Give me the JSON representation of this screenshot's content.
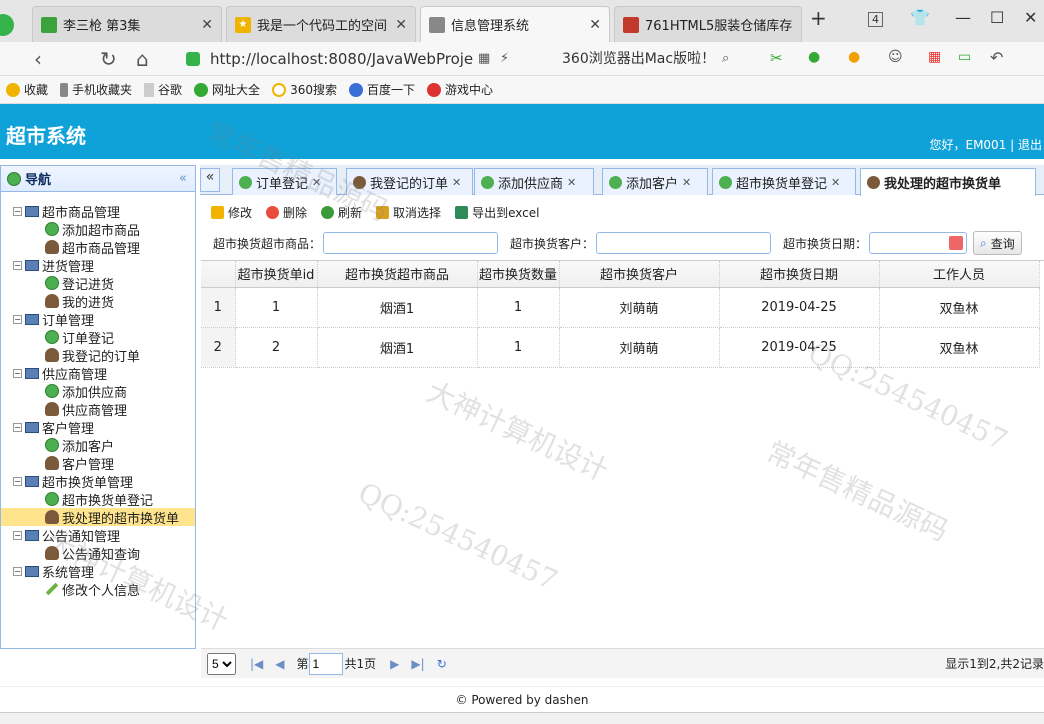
{
  "browser": {
    "tabs": [
      {
        "title": "李三枪 第3集",
        "color": "#3ca33b"
      },
      {
        "title": "我是一个代码工的空间 [h",
        "color": "#f0b400"
      },
      {
        "title": "信息管理系统",
        "color": "#888888",
        "active": true
      },
      {
        "title": "761HTML5服装仓储库存",
        "color": "#c0392b"
      }
    ],
    "new_tab": "+",
    "tab_count": "4",
    "url": "http://localhost:8080/JavaWebProje",
    "promo": "360浏览器出Mac版啦！"
  },
  "bookmarks": [
    "收藏",
    "手机收藏夹",
    "谷歌",
    "网址大全",
    "360搜索",
    "百度一下",
    "游戏中心"
  ],
  "app": {
    "title": "超市系统",
    "greeting": "您好，EM001 | 退出"
  },
  "nav": {
    "title": "导航",
    "collapse": "«",
    "tree": [
      {
        "label": "超市商品管理",
        "type": "group"
      },
      {
        "label": "添加超市商品",
        "type": "leaf",
        "icon": "add"
      },
      {
        "label": "超市商品管理",
        "type": "leaf",
        "icon": "user"
      },
      {
        "label": "进货管理",
        "type": "group"
      },
      {
        "label": "登记进货",
        "type": "leaf",
        "icon": "add"
      },
      {
        "label": "我的进货",
        "type": "leaf",
        "icon": "user"
      },
      {
        "label": "订单管理",
        "type": "group"
      },
      {
        "label": "订单登记",
        "type": "leaf",
        "icon": "add"
      },
      {
        "label": "我登记的订单",
        "type": "leaf",
        "icon": "user"
      },
      {
        "label": "供应商管理",
        "type": "group"
      },
      {
        "label": "添加供应商",
        "type": "leaf",
        "icon": "add"
      },
      {
        "label": "供应商管理",
        "type": "leaf",
        "icon": "user"
      },
      {
        "label": "客户管理",
        "type": "group"
      },
      {
        "label": "添加客户",
        "type": "leaf",
        "icon": "add"
      },
      {
        "label": "客户管理",
        "type": "leaf",
        "icon": "user"
      },
      {
        "label": "超市换货单管理",
        "type": "group"
      },
      {
        "label": "超市换货单登记",
        "type": "leaf",
        "icon": "add"
      },
      {
        "label": "我处理的超市换货单",
        "type": "leaf",
        "icon": "user",
        "selected": true
      },
      {
        "label": "公告通知管理",
        "type": "group"
      },
      {
        "label": "公告通知查询",
        "type": "leaf",
        "icon": "user"
      },
      {
        "label": "系统管理",
        "type": "group"
      },
      {
        "label": "修改个人信息",
        "type": "leaf",
        "icon": "pen"
      }
    ]
  },
  "panel_tabs": [
    {
      "label": "订单登记",
      "icon": "add"
    },
    {
      "label": "我登记的订单",
      "icon": "user"
    },
    {
      "label": "添加供应商",
      "icon": "add"
    },
    {
      "label": "添加客户",
      "icon": "add"
    },
    {
      "label": "超市换货单登记",
      "icon": "add"
    },
    {
      "label": "我处理的超市换货单",
      "icon": "user",
      "active": true
    }
  ],
  "toolbar": {
    "edit": "修改",
    "delete": "删除",
    "refresh": "刷新",
    "cancel_select": "取消选择",
    "export": "导出到excel"
  },
  "search": {
    "goods_label": "超市换货超市商品：",
    "customer_label": "超市换货客户：",
    "date_label": "超市换货日期：",
    "query": "查询"
  },
  "grid": {
    "columns": [
      "超市换货单id",
      "超市换货超市商品",
      "超市换货数量",
      "超市换货客户",
      "超市换货日期",
      "工作人员"
    ],
    "rows": [
      [
        "1",
        "1",
        "烟酒1",
        "1",
        "刘萌萌",
        "2019-04-25",
        "双鱼林"
      ],
      [
        "2",
        "2",
        "烟酒1",
        "1",
        "刘萌萌",
        "2019-04-25",
        "双鱼林"
      ]
    ]
  },
  "pager": {
    "page_size": "5",
    "page_prefix": "第",
    "page_value": "1",
    "page_suffix": "共1页",
    "info": "显示1到2,共2记录"
  },
  "footer": "© Powered by dashen",
  "watermarks": [
    "常年售精品源码",
    "大神计算机设计",
    "QQ:254540457"
  ]
}
